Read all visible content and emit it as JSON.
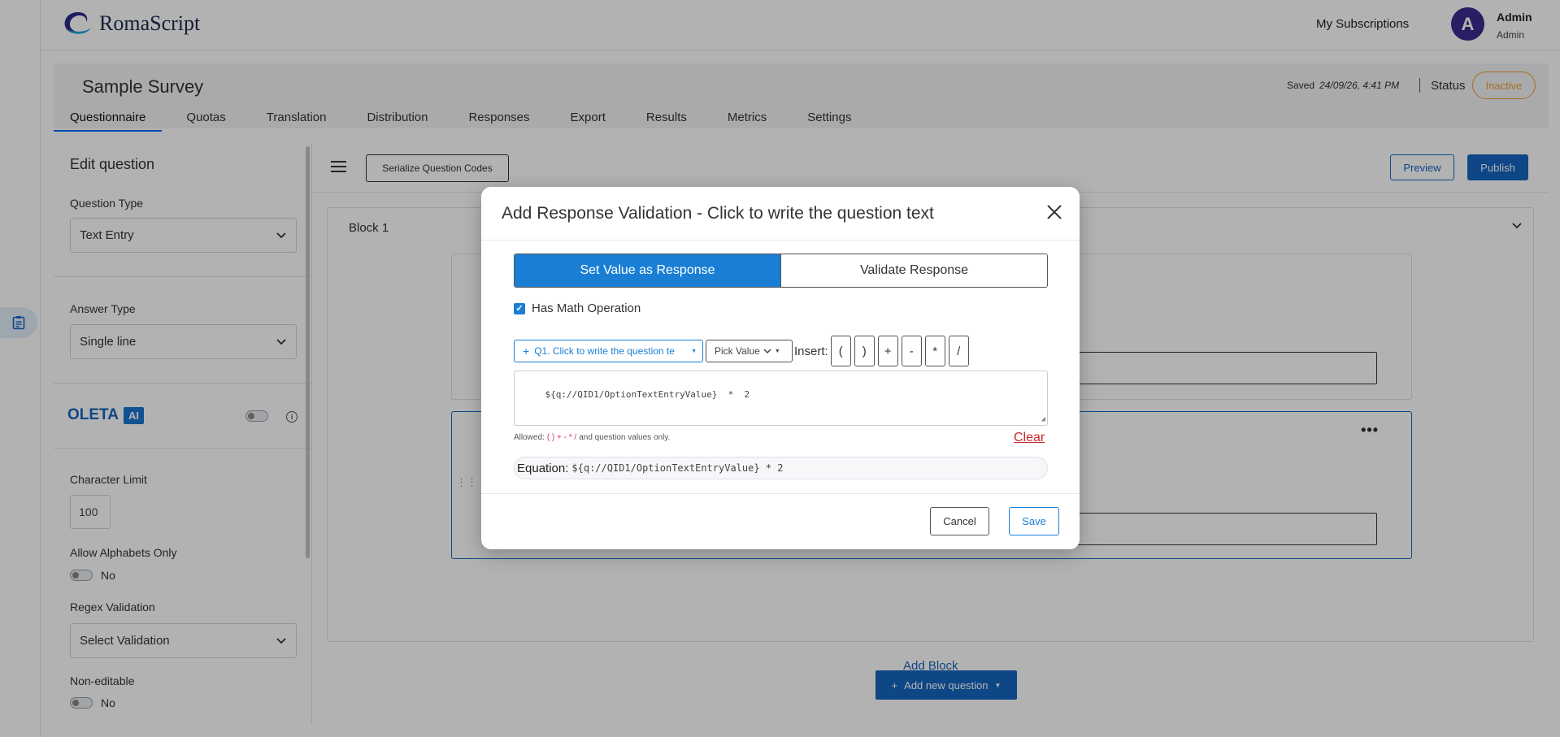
{
  "header": {
    "logo_text": "RomaScript",
    "subscriptions_link": "My Subscriptions",
    "avatar_initial": "A",
    "user_name": "Admin",
    "user_role": "Admin"
  },
  "survey": {
    "title": "Sample Survey",
    "saved_label": "Saved",
    "saved_time": "24/09/26, 4:41 PM",
    "status_label": "Status",
    "status_value": "Inactive",
    "tabs": [
      {
        "label": "Questionnaire",
        "active": true
      },
      {
        "label": "Quotas"
      },
      {
        "label": "Translation"
      },
      {
        "label": "Distribution"
      },
      {
        "label": "Responses"
      },
      {
        "label": "Export"
      },
      {
        "label": "Results"
      },
      {
        "label": "Metrics"
      },
      {
        "label": "Settings"
      }
    ]
  },
  "edit_panel": {
    "title": "Edit question",
    "question_type_label": "Question Type",
    "question_type_value": "Text Entry",
    "answer_type_label": "Answer Type",
    "answer_type_value": "Single line",
    "oleta_text": "OLETA",
    "ai_badge": "AI",
    "char_limit_label": "Character Limit",
    "char_limit_value": "100",
    "alphabets_label": "Allow Alphabets Only",
    "alphabets_value": "No",
    "regex_label": "Regex Validation",
    "regex_value": "Select Validation",
    "non_editable_label": "Non-editable",
    "non_editable_value": "No"
  },
  "toolbar": {
    "serialize_label": "Serialize Question Codes",
    "preview_label": "Preview",
    "publish_label": "Publish"
  },
  "block": {
    "title": "Block 1",
    "add_question_label": "Add new question",
    "add_block_label": "Add Block"
  },
  "modal": {
    "title": "Add Response Validation - Click to write the question text",
    "tab_set_value": "Set Value as Response",
    "tab_validate": "Validate Response",
    "math_checkbox_label": "Has Math Operation",
    "question_dropdown": "Q1. Click to write the question te",
    "pick_value_dropdown": "Pick Value",
    "insert_label": "Insert:",
    "operators": [
      "(",
      ")",
      "+",
      "-",
      "*",
      "/"
    ],
    "expression": "${q://QID1/OptionTextEntryValue}  *  2",
    "allowed_prefix": "Allowed:",
    "allowed_ops": "( ) + - * /",
    "allowed_suffix": "and question values only.",
    "clear_label": "Clear",
    "equation_label": "Equation:",
    "equation_value": "${q://QID1/OptionTextEntryValue} * 2",
    "cancel_label": "Cancel",
    "save_label": "Save"
  },
  "colors": {
    "primary": "#1565c0",
    "accent_blue": "#1a7fd4",
    "status_inactive": "#f0a030",
    "clear_red": "#c62828",
    "avatar_bg": "#3b2a8f"
  },
  "icons": {
    "logo": "romascript-logo-icon",
    "rail": "clipboard-icon",
    "menu": "hamburger-icon",
    "close": "close-icon",
    "chevron": "chevron-down-icon",
    "info": "info-icon"
  }
}
